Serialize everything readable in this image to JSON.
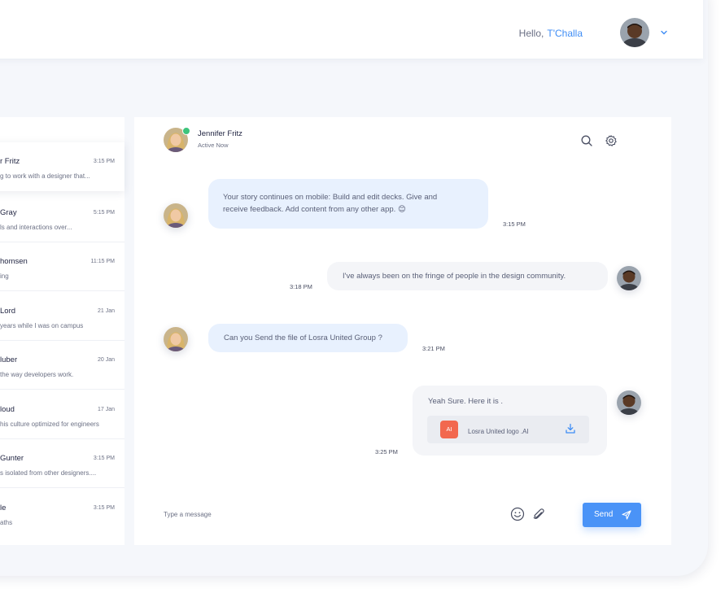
{
  "header": {
    "greeting": "Hello,",
    "user_name": "T'Challa"
  },
  "conversations": [
    {
      "name": "r Fritz",
      "time": "3:15 PM",
      "preview": "g to work with a designer that...",
      "active": true
    },
    {
      "name": "Gray",
      "time": "5:15 PM",
      "preview": "ls and interactions over...",
      "active": false
    },
    {
      "name": "homsen",
      "time": "11:15 PM",
      "preview": "ing",
      "active": false
    },
    {
      "name": "Lord",
      "time": "21 Jan",
      "preview": " years while I was on campus",
      "active": false
    },
    {
      "name": "luber",
      "time": "20 Jan",
      "preview": "the way developers work.",
      "active": false
    },
    {
      "name": "loud",
      "time": "17 Jan",
      "preview": "his culture optimized for engineers",
      "active": false
    },
    {
      "name": "Gunter",
      "time": "3:15 PM",
      "preview": "s isolated from other designers....",
      "active": false
    },
    {
      "name": "le",
      "time": "3:15 PM",
      "preview": "aths",
      "active": false
    }
  ],
  "chat": {
    "contact_name": "Jennifer Fritz",
    "contact_status": "Active Now",
    "messages": [
      {
        "from": "them",
        "text_line1": "Your story continues on mobile: Build and edit decks. Give and",
        "text_line2": "receive feedback. Add content from any other app. 😊",
        "time": "3:15 PM"
      },
      {
        "from": "me",
        "text": "I've always been on the fringe of people in the design community.",
        "time": "3:18 PM"
      },
      {
        "from": "them",
        "text": "Can you Send the file of Losra United Group ?",
        "time": "3:21 PM"
      },
      {
        "from": "me",
        "text": "Yeah Sure. Here it is .",
        "time": "3:25 PM",
        "attachment": {
          "badge": "AI",
          "name": "Losra United logo .AI"
        }
      }
    ],
    "input_placeholder": "Type a message",
    "send_label": "Send"
  },
  "colors": {
    "accent": "#4a93f7",
    "online": "#3cc47c",
    "file_badge": "#f2684f"
  },
  "icons": [
    "chevron-down-icon",
    "search-icon",
    "gear-icon",
    "download-icon",
    "emoji-icon",
    "paperclip-icon",
    "send-icon"
  ]
}
